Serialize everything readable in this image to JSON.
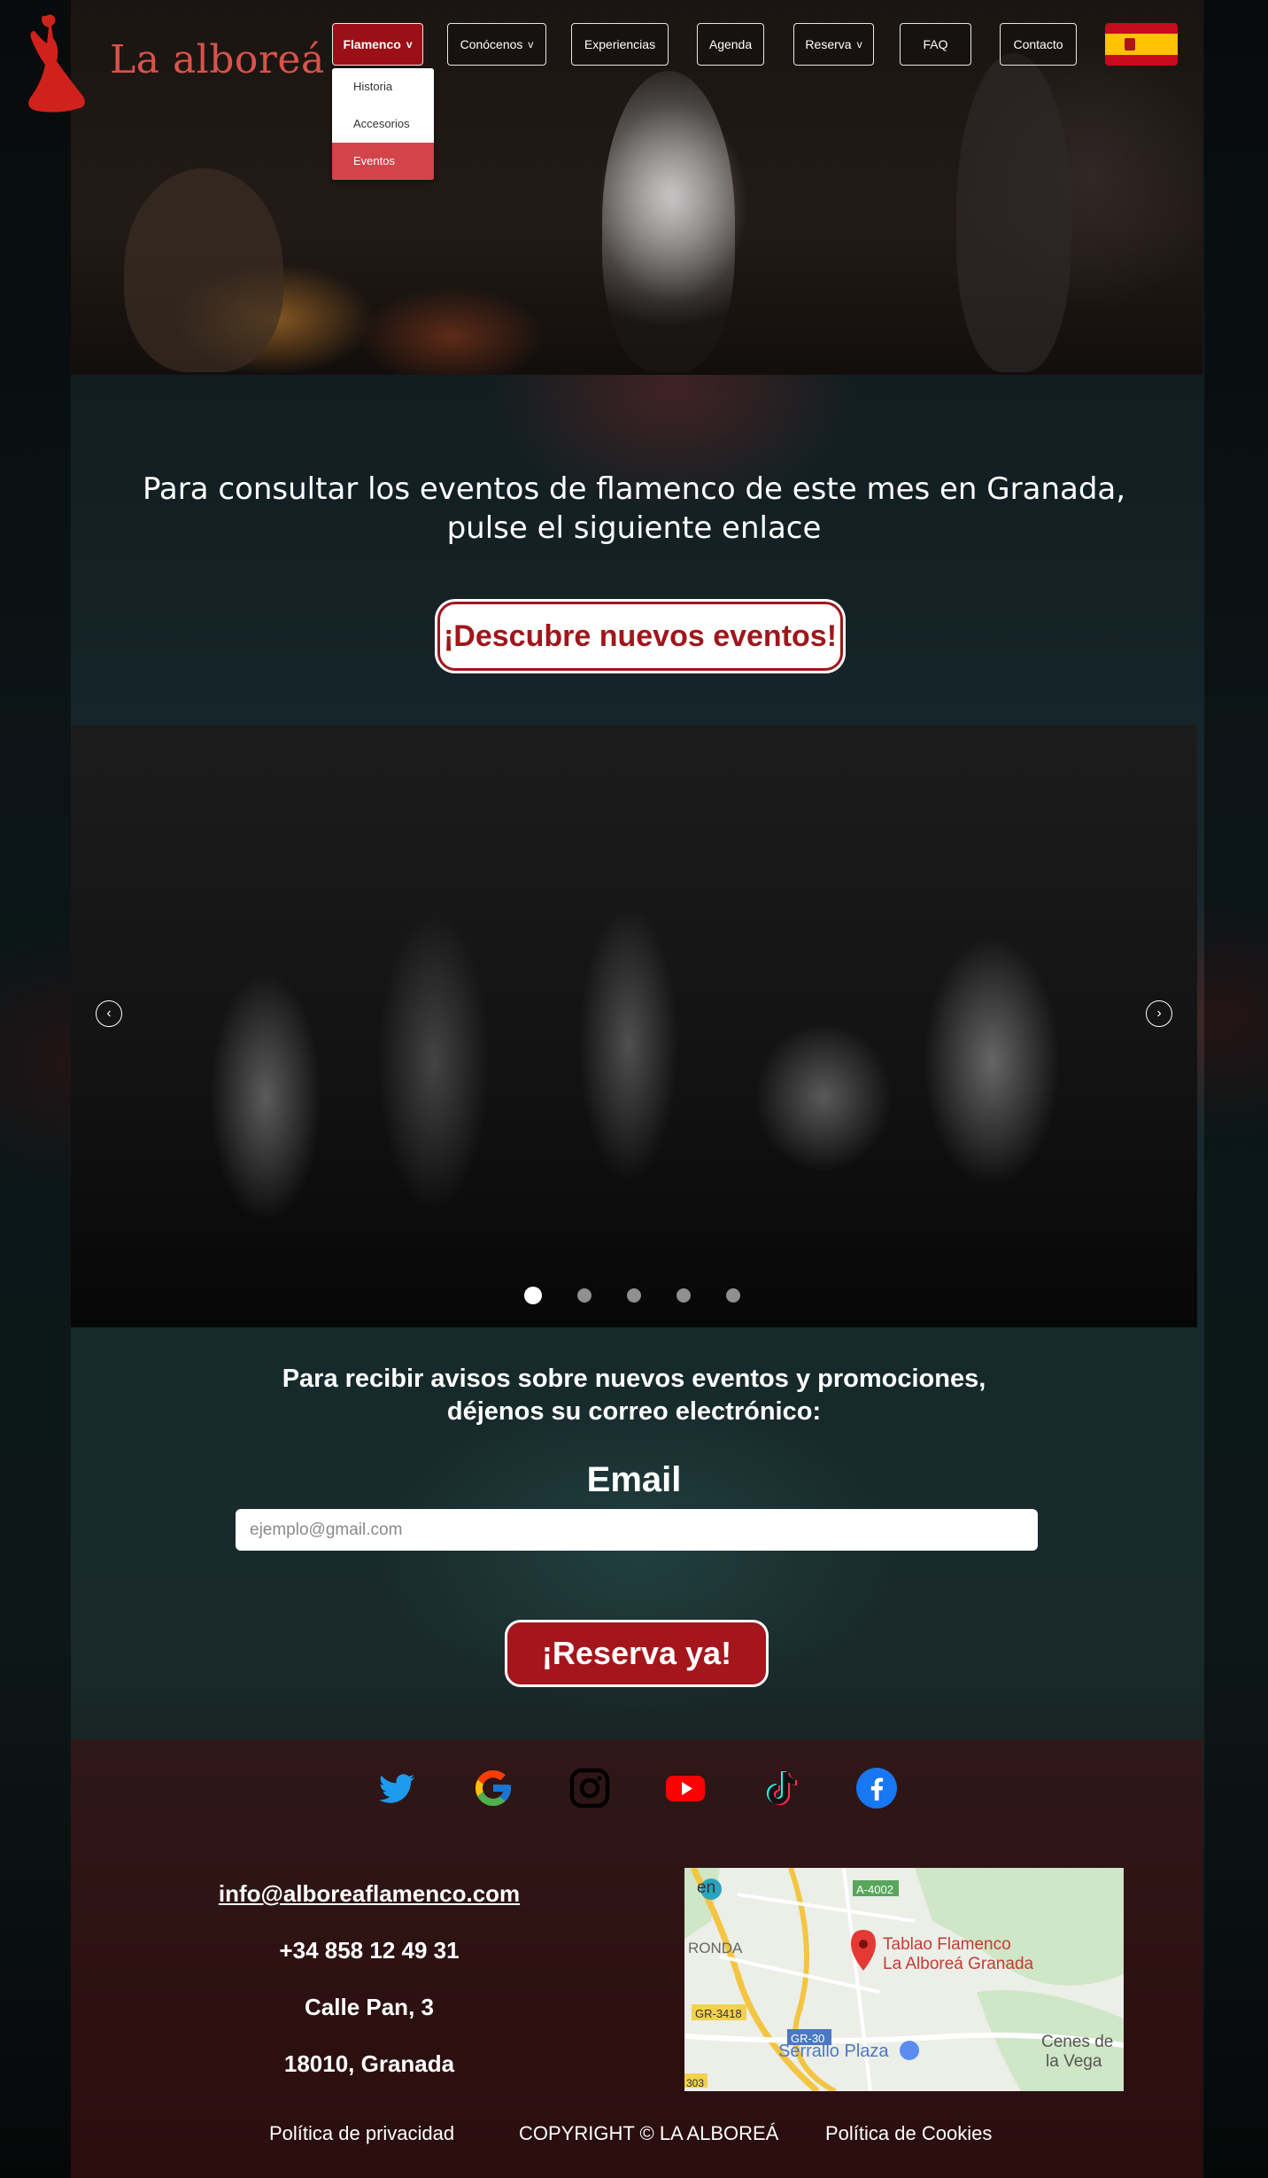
{
  "brand": {
    "name": "La alboreá",
    "accent": "#a0161b"
  },
  "nav": {
    "items": [
      {
        "label": "Flamenco",
        "has_menu": true,
        "active": true
      },
      {
        "label": "Conócenos",
        "has_menu": true
      },
      {
        "label": "Experiencias"
      },
      {
        "label": "Agenda"
      },
      {
        "label": "Reserva",
        "has_menu": true
      },
      {
        "label": "FAQ"
      },
      {
        "label": "Contacto"
      }
    ],
    "dropdown": [
      "Historia",
      "Accesorios",
      "Eventos"
    ],
    "dropdown_selected": "Eventos",
    "language_flag": "spain-flag-icon"
  },
  "events": {
    "text_line1": "Para consultar los eventos de flamenco de este mes en Granada,",
    "text_line2": "pulse el siguiente enlace",
    "button": "¡Descubre nuevos eventos!"
  },
  "carousel": {
    "slide_count": 5,
    "active_slide": 1
  },
  "newsletter": {
    "text_line1": "Para recibir avisos sobre nuevos eventos y promociones,",
    "text_line2": "déjenos su correo electrónico:",
    "email_label": "Email",
    "email_placeholder": "ejemplo@gmail.com",
    "button": "¡Reserva ya!"
  },
  "footer": {
    "social": [
      "twitter-icon",
      "google-icon",
      "instagram-icon",
      "youtube-icon",
      "tiktok-icon",
      "facebook-icon"
    ],
    "email": "info@alboreaflamenco.com",
    "phone": "+34 858 12 49 31",
    "street": "Calle Pan, 3",
    "city": "18010, Granada",
    "map": {
      "pin_line1": "Tablao Flamenco",
      "pin_line2": "La Alboreá Granada",
      "place": "Serrallo Plaza",
      "town_line1": "Cenes de",
      "town_line2": "la Vega",
      "road1": "A-4002",
      "road2": "GR-3418",
      "road3": "GR-30",
      "area": "RONDA",
      "road4": "303",
      "fragment": "en"
    },
    "privacy": "Política de privacidad",
    "copyright": "COPYRIGHT © LA ALBOREÁ",
    "cookies": "Política de Cookies"
  }
}
